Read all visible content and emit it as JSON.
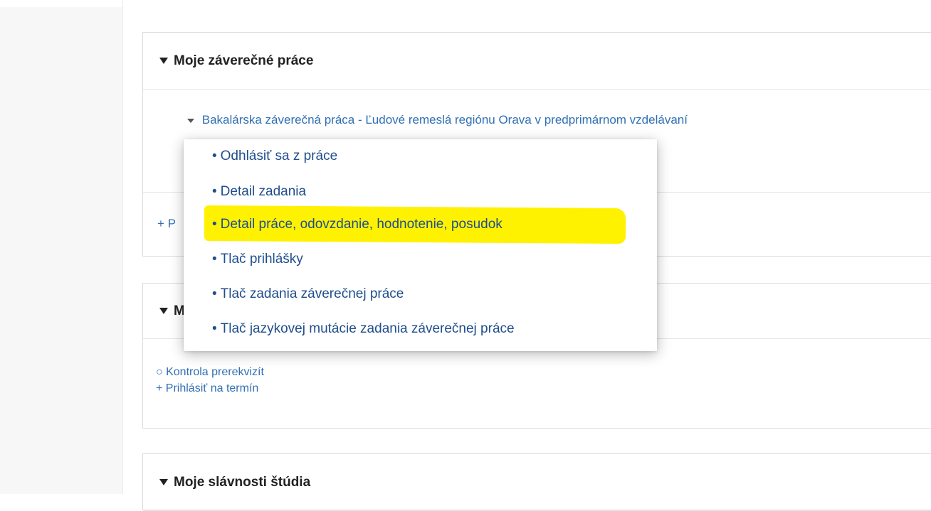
{
  "panels": {
    "my_theses": {
      "title": "Moje záverečné práce",
      "thesis_link": "Bakalárska záverečná práca - Ľudové remeslá regiónu Orava v predprimárnom vzdelávaní",
      "add_link": "+ P"
    },
    "second": {
      "title_partial": "M",
      "links": [
        "○ Kontrola prerekvizít",
        "+ Prihlásiť na termín"
      ]
    },
    "celebrations": {
      "title": "Moje slávnosti štúdia"
    }
  },
  "menu": {
    "items": [
      "Odhlásiť sa z práce",
      "Detail zadania",
      "Detail práce, odovzdanie, hodnotenie, posudok",
      "Tlač prihlášky",
      "Tlač zadania záverečnej práce",
      "Tlač jazykovej mutácie zadania záverečnej práce"
    ],
    "highlighted_index": 2,
    "bullet": "•"
  },
  "colors": {
    "link": "#2f6fb3",
    "menu_text": "#1f4e8c",
    "highlight": "#fff200"
  }
}
